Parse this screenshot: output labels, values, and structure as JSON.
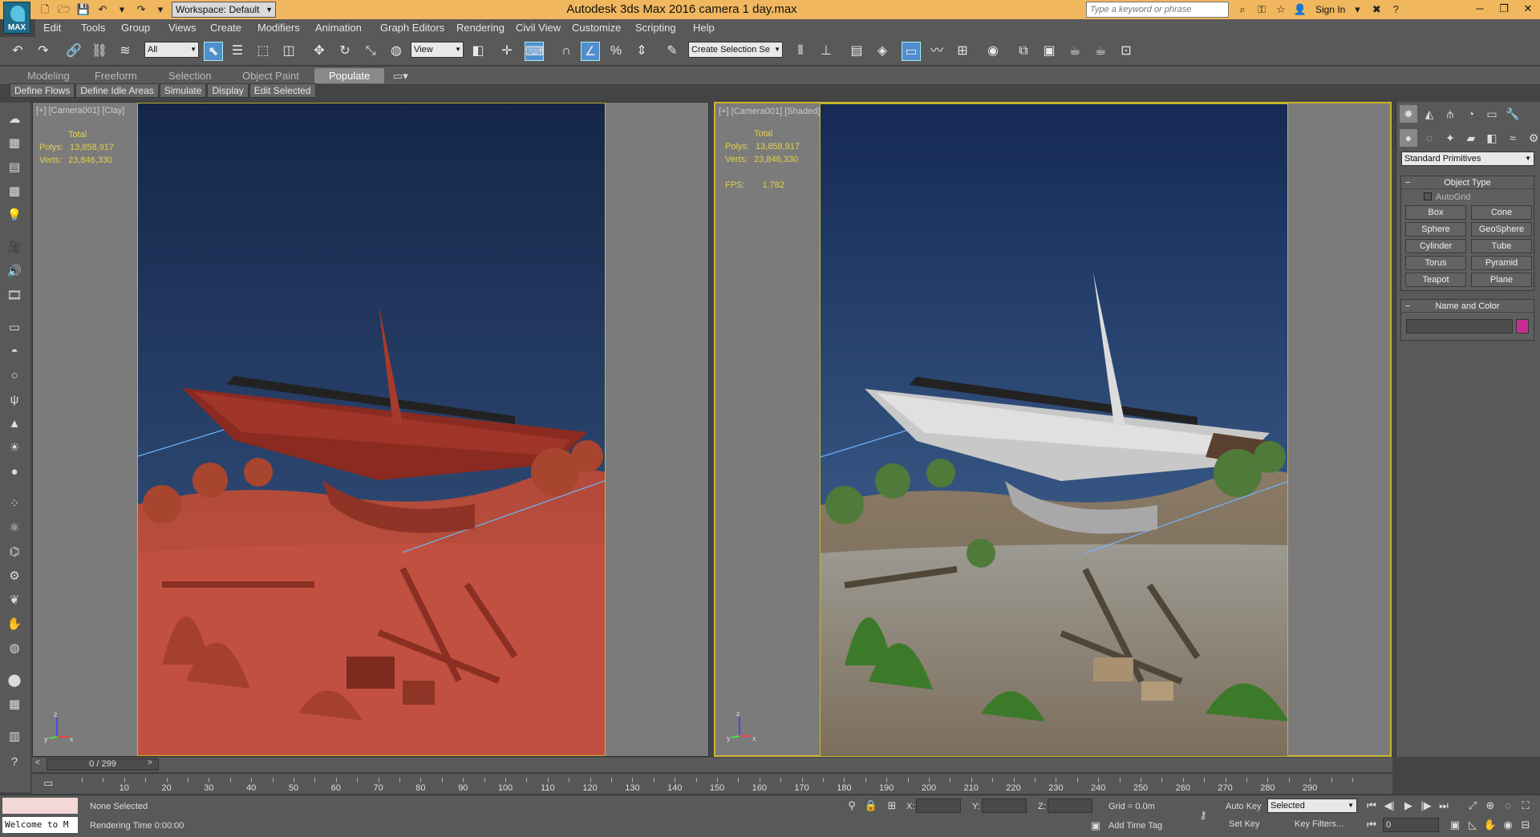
{
  "titlebar": {
    "logo_text": "MAX",
    "workspace": "Workspace: Default",
    "title": "Autodesk 3ds Max 2016      camera 1 day.max",
    "search_placeholder": "Type a keyword or phrase",
    "sign_in": "Sign In"
  },
  "menu": [
    "Edit",
    "Tools",
    "Group",
    "Views",
    "Create",
    "Modifiers",
    "Animation",
    "Graph Editors",
    "Rendering",
    "Civil View",
    "Customize",
    "Scripting",
    "Help"
  ],
  "toolbar": {
    "selection_filter": "All",
    "reference_coord": "View",
    "named_selection": "Create Selection Se"
  },
  "ribbon": {
    "tabs": [
      "Modeling",
      "Freeform",
      "Selection",
      "Object Paint",
      "Populate"
    ],
    "active_tab": "Populate",
    "sub_buttons": [
      "Define Flows",
      "Define Idle Areas",
      "Simulate",
      "Display",
      "Edit Selected"
    ]
  },
  "viewports": {
    "left": {
      "label": "[+] [Camera001] [Clay]",
      "stats_total": "Total",
      "polys_label": "Polys:",
      "polys": "13,858,917",
      "verts_label": "Verts:",
      "verts": "23,846,330"
    },
    "right": {
      "label": "[+] [Camera001] [Shaded]",
      "stats_total": "Total",
      "polys_label": "Polys:",
      "polys": "13,858,917",
      "verts_label": "Verts:",
      "verts": "23,846,330",
      "fps_label": "FPS:",
      "fps": "1.782"
    }
  },
  "command_panel": {
    "category": "Standard Primitives",
    "object_type_title": "Object Type",
    "autogrid": "AutoGrid",
    "buttons": [
      "Box",
      "Cone",
      "Sphere",
      "GeoSphere",
      "Cylinder",
      "Tube",
      "Torus",
      "Pyramid",
      "Teapot",
      "Plane"
    ],
    "name_color_title": "Name and Color"
  },
  "timeline": {
    "frame_display": "0 / 299",
    "ticks": [
      "10",
      "20",
      "30",
      "40",
      "50",
      "60",
      "70",
      "80",
      "90",
      "100",
      "110",
      "120",
      "130",
      "140",
      "150",
      "160",
      "170",
      "180",
      "190",
      "200",
      "210",
      "220",
      "230",
      "240",
      "250",
      "260",
      "270",
      "280",
      "290"
    ]
  },
  "status": {
    "maxscript": "Welcome to M",
    "selection": "None Selected",
    "rendering_time": "Rendering Time 0:00:00",
    "x_label": "X:",
    "y_label": "Y:",
    "z_label": "Z:",
    "grid": "Grid = 0.0m",
    "add_time_tag": "Add Time Tag",
    "auto_key": "Auto Key",
    "set_key": "Set Key",
    "selected_dd": "Selected",
    "key_filters": "Key Filters...",
    "frame_field": "0"
  }
}
